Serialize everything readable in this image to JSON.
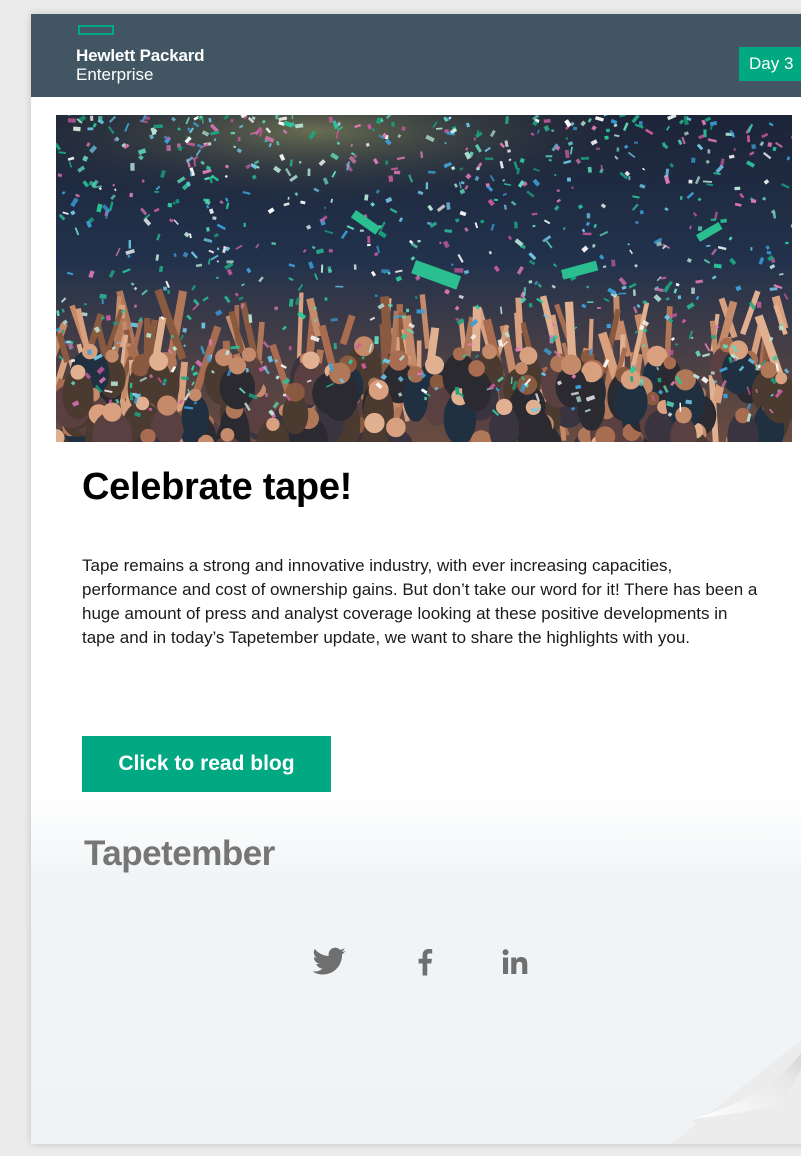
{
  "header": {
    "logo_line1": "Hewlett Packard",
    "logo_line2": "Enterprise",
    "day_badge": "Day 3"
  },
  "hero": {
    "description": "confetti-crowd-photo"
  },
  "main": {
    "headline": "Celebrate tape!",
    "body": "Tape remains a strong and innovative industry, with ever increasing capacities, performance and cost of ownership gains. But don’t take our word for it! There has been a huge amount of press and analyst coverage looking at these positive developments in tape and in today’s Tapetember update, we want to share the highlights with you.",
    "cta_label": "Click to read blog"
  },
  "footer": {
    "brand": "Tapetember",
    "social": [
      {
        "icon": "twitter-icon",
        "glyph": "🐦"
      },
      {
        "icon": "facebook-icon",
        "glyph": "f"
      },
      {
        "icon": "linkedin-icon",
        "glyph": "in"
      }
    ]
  },
  "colors": {
    "header_bg": "#425563",
    "accent_green": "#01a982",
    "brand_gray": "#767676"
  }
}
